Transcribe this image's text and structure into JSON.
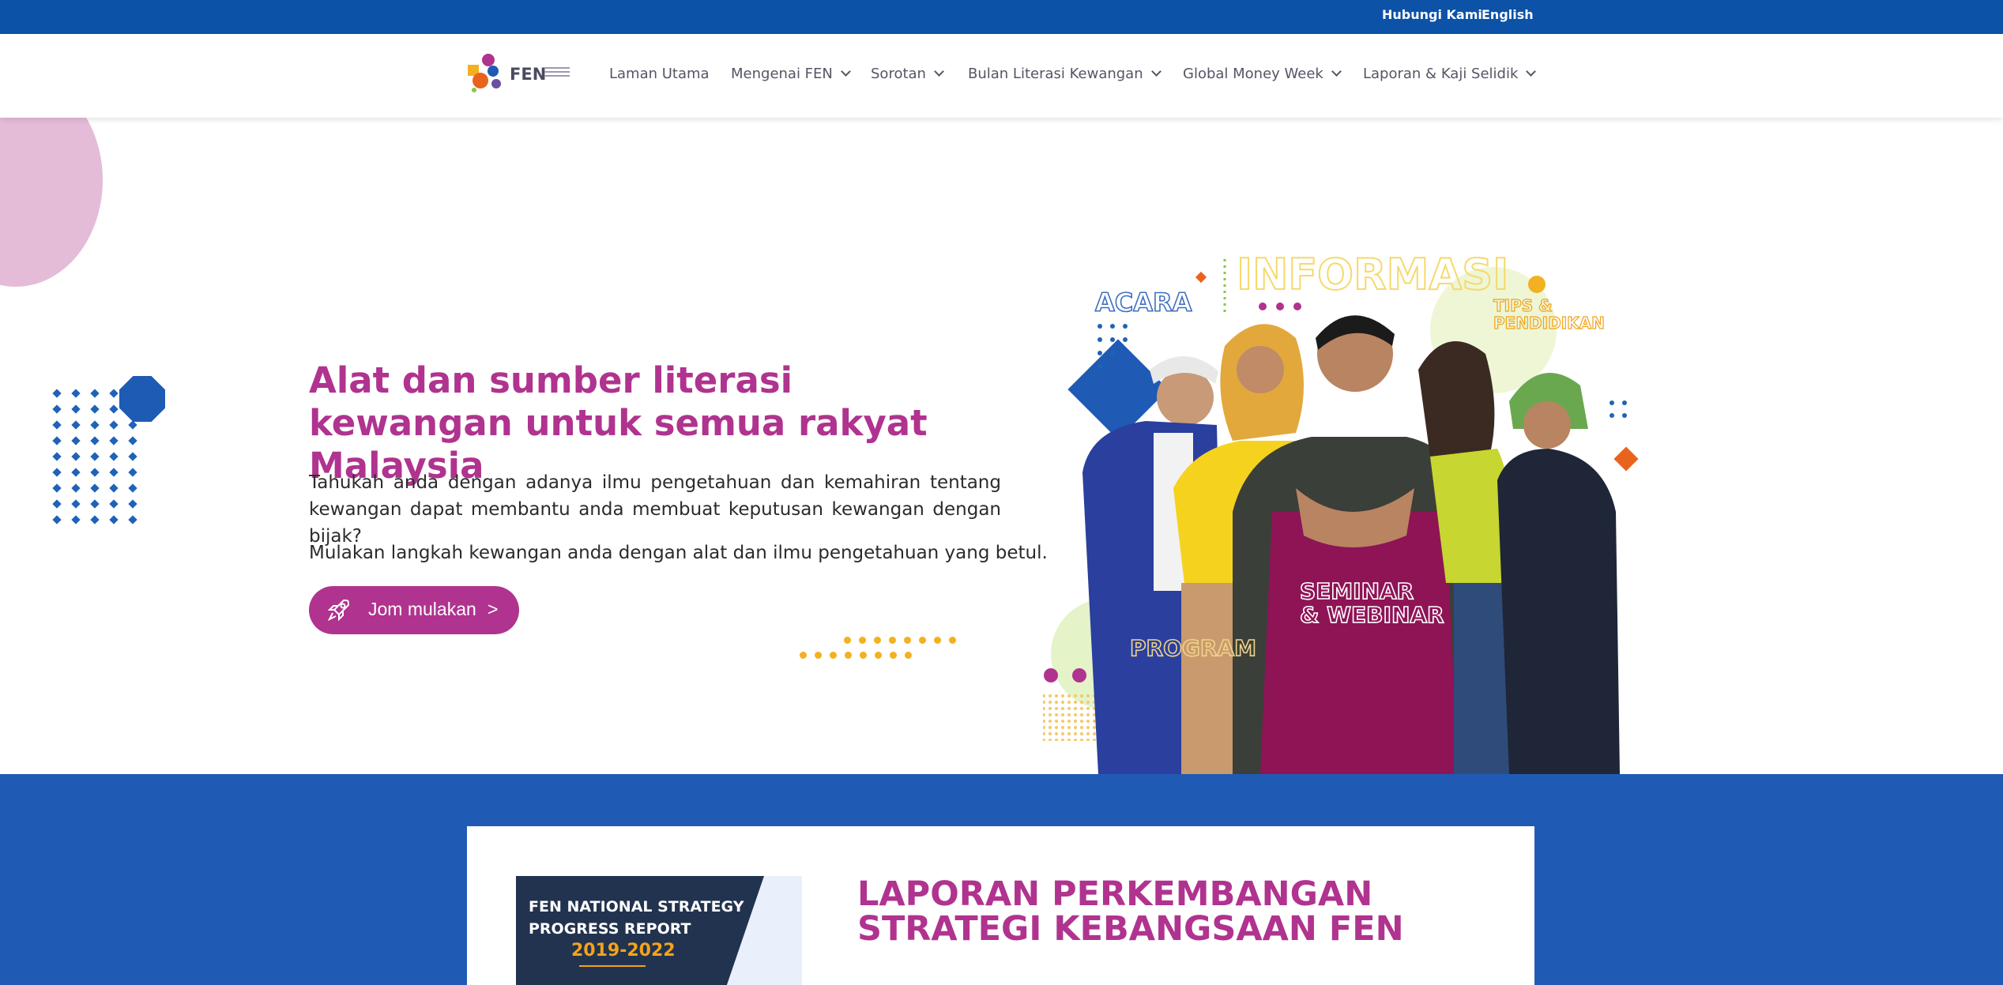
{
  "topbar": {
    "contact": "Hubungi Kami",
    "language": "English"
  },
  "header": {
    "logo_text": "FEN",
    "nav": [
      {
        "label": "Laman Utama",
        "dropdown": false
      },
      {
        "label": "Mengenai FEN",
        "dropdown": true
      },
      {
        "label": "Sorotan",
        "dropdown": true
      },
      {
        "label": "Bulan Literasi Kewangan",
        "dropdown": true
      },
      {
        "label": "Global Money Week",
        "dropdown": true
      },
      {
        "label": "Laporan & Kaji Selidik",
        "dropdown": true
      }
    ]
  },
  "hero": {
    "title": "Alat dan sumber literasi kewangan untuk semua rakyat Malaysia",
    "paragraph1": "Tahukah anda dengan adanya ilmu pengetahuan dan kemahiran tentang kewangan dapat membantu anda membuat keputusan kewangan dengan bijak?",
    "paragraph2": "Mulakan langkah kewangan anda dengan alat dan ilmu pengetahuan yang betul.",
    "cta": {
      "label": "Jom mulakan",
      "arrow": ">",
      "icon": "rocket-icon"
    },
    "illustration": {
      "words": [
        "INFORMASI",
        "ACARA",
        "TIPS &",
        "PENDIDIKAN",
        "SEMINAR",
        "& WEBINAR",
        "PROGRAM"
      ]
    }
  },
  "report": {
    "cover_lines": [
      "FEN NATIONAL STRATEGY",
      "PROGRESS REPORT"
    ],
    "cover_years": "2019-2022",
    "title_line1": "LAPORAN PERKEMBANGAN",
    "title_line2": "STRATEGI KEBANGSAAN FEN"
  },
  "colors": {
    "topbar": "#0c52a7",
    "accent_magenta": "#b0338f",
    "section_blue": "#1f5bb5",
    "yellow": "#f3b021"
  }
}
